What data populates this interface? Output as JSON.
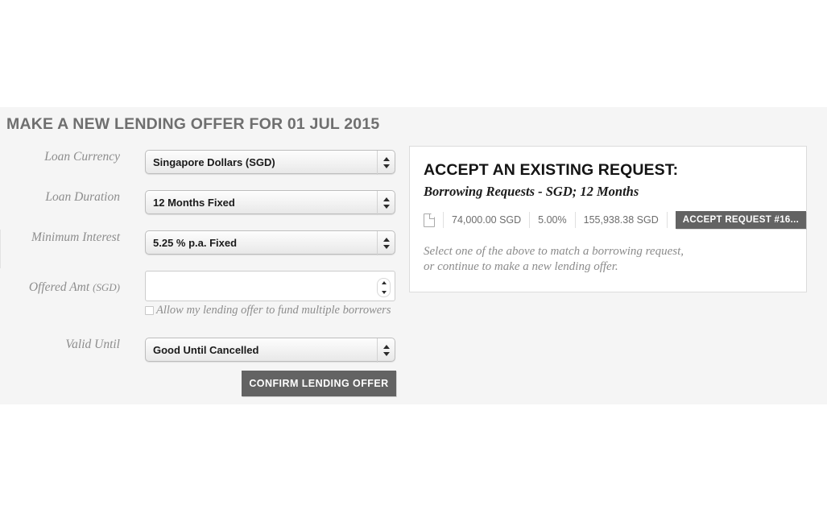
{
  "page": {
    "title": "MAKE A NEW LENDING OFFER FOR 01 JUL 2015"
  },
  "form": {
    "rows": [
      {
        "label": "Loan Currency",
        "label_suffix": "",
        "type": "select",
        "value": "Singapore Dollars (SGD)"
      },
      {
        "label": "Loan Duration",
        "label_suffix": "",
        "type": "select",
        "value": "12 Months Fixed"
      },
      {
        "label": "Minimum Interest",
        "label_suffix": "",
        "type": "select",
        "value": "5.25 % p.a. Fixed"
      },
      {
        "label": "Offered Amt",
        "label_suffix": "(SGD)",
        "type": "number",
        "value": "",
        "placeholder": ""
      },
      {
        "label": "Valid Until",
        "label_suffix": "",
        "type": "select",
        "value": "Good Until Cancelled"
      }
    ],
    "checkbox": {
      "label": "Allow my lending offer to fund multiple borrowers",
      "checked": false
    },
    "confirm_label": "CONFIRM LENDING OFFER"
  },
  "request_panel": {
    "heading": "ACCEPT AN EXISTING REQUEST:",
    "subheading": "Borrowing Requests - SGD; 12 Months",
    "row": {
      "icon": "document-icon",
      "amount": "74,000.00 SGD",
      "rate": "5.00%",
      "total": "155,938.38 SGD",
      "accept_label": "ACCEPT REQUEST #16..."
    },
    "note_line1": "Select one of the above to match a borrowing request,",
    "note_line2": "or continue to make a new lending offer."
  },
  "colors": {
    "panel_bg": "#f5f5f5",
    "button": "#636363",
    "title": "#6f6f6f"
  }
}
